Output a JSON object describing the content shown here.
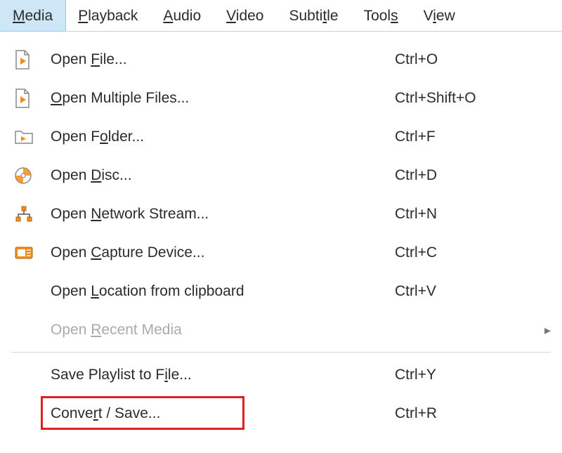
{
  "menubar": {
    "items": [
      {
        "pre": "",
        "mn": "M",
        "post": "edia",
        "active": true
      },
      {
        "pre": "",
        "mn": "P",
        "post": "layback",
        "active": false
      },
      {
        "pre": "",
        "mn": "A",
        "post": "udio",
        "active": false
      },
      {
        "pre": "",
        "mn": "V",
        "post": "ideo",
        "active": false
      },
      {
        "pre": "Subti",
        "mn": "t",
        "post": "le",
        "active": false
      },
      {
        "pre": "Tool",
        "mn": "s",
        "post": "",
        "active": false
      },
      {
        "pre": "V",
        "mn": "i",
        "post": "ew",
        "active": false
      }
    ]
  },
  "menu": {
    "items": [
      {
        "icon": "file-play-icon",
        "pre": "Open ",
        "mn": "F",
        "post": "ile...",
        "shortcut": "Ctrl+O"
      },
      {
        "icon": "file-play-icon",
        "pre": "",
        "mn": "O",
        "post": "pen Multiple Files...",
        "shortcut": "Ctrl+Shift+O"
      },
      {
        "icon": "folder-play-icon",
        "pre": "Open F",
        "mn": "o",
        "post": "lder...",
        "shortcut": "Ctrl+F"
      },
      {
        "icon": "disc-icon",
        "pre": "Open ",
        "mn": "D",
        "post": "isc...",
        "shortcut": "Ctrl+D"
      },
      {
        "icon": "network-icon",
        "pre": "Open ",
        "mn": "N",
        "post": "etwork Stream...",
        "shortcut": "Ctrl+N"
      },
      {
        "icon": "capture-icon",
        "pre": "Open ",
        "mn": "C",
        "post": "apture Device...",
        "shortcut": "Ctrl+C"
      },
      {
        "icon": "",
        "pre": "Open ",
        "mn": "L",
        "post": "ocation from clipboard",
        "shortcut": "Ctrl+V"
      },
      {
        "icon": "",
        "pre": "Open ",
        "mn": "R",
        "post": "ecent Media",
        "shortcut": "",
        "disabled": true,
        "submenu": true
      },
      {
        "sep": true
      },
      {
        "icon": "",
        "pre": "Save Playlist to F",
        "mn": "i",
        "post": "le...",
        "shortcut": "Ctrl+Y"
      },
      {
        "icon": "",
        "pre": "Conve",
        "mn": "r",
        "post": "t / Save...",
        "shortcut": "Ctrl+R",
        "highlight": true
      }
    ]
  },
  "colors": {
    "accent": "#f28c1a",
    "highlight": "#e02020",
    "menubar_active": "#cde7f6"
  },
  "submenu_arrow": "▸"
}
